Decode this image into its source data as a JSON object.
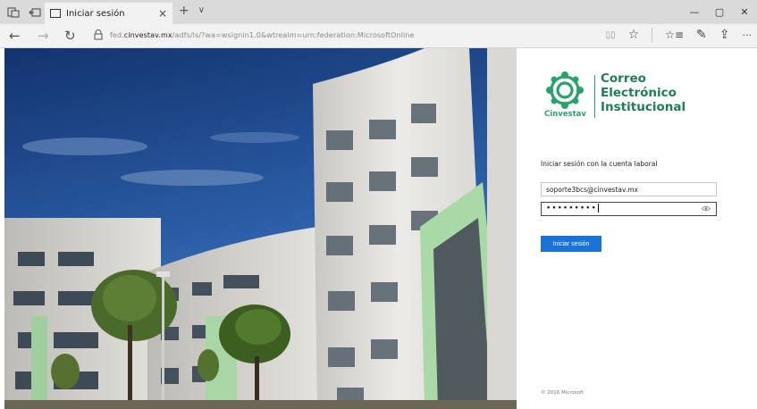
{
  "browser": {
    "tab_title": "Iniciar sesión",
    "tab_close": "×",
    "new_tab": "+",
    "tab_menu": "∨",
    "url_host_prefix": "fed.",
    "url_host": "cinvestav.mx",
    "url_path": "/adfs/ls/?wa=wsignin1.0&wtrealm=urn:federation:MicrosoftOnline",
    "win_min": "—",
    "win_max": "▢",
    "win_close": "✕"
  },
  "icons": {
    "back": "←",
    "forward": "→",
    "refresh": "↻",
    "reading_view": "▯▯",
    "favorite": "☆",
    "favorites_hub": "☆≡",
    "pen": "✎",
    "share": "⇪",
    "more": "···"
  },
  "logo": {
    "word": "Cinvestav",
    "title_lines": [
      "Correo",
      "Electrónico",
      "Institucional"
    ],
    "color": "#29a36a"
  },
  "login": {
    "prompt": "Iniciar sesión con la cuenta laboral",
    "email_value": "soporte3bcs@cinvestav.mx",
    "password_value": "•••••••••",
    "submit_label": "Iniciar sesión",
    "accent": "#1a73d6"
  },
  "footer": {
    "copyright": "© 2016 Microsoft"
  }
}
